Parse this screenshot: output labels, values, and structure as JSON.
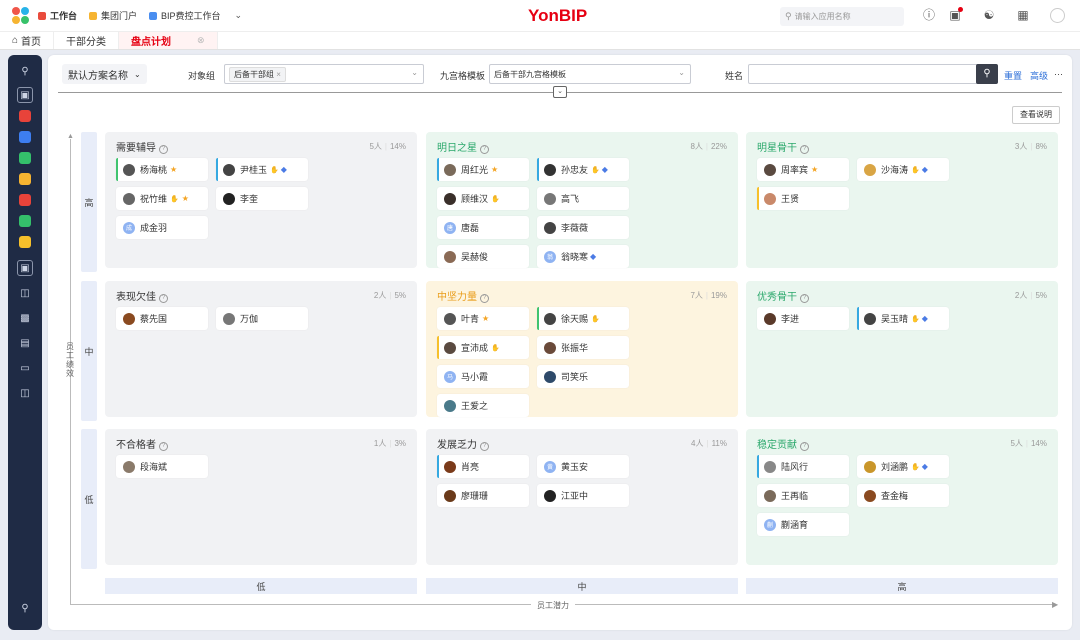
{
  "topbar": {
    "tabs": [
      {
        "label": "工作台",
        "color": "#e94b3c",
        "active": true
      },
      {
        "label": "集团门户",
        "color": "#f6b431",
        "active": false
      },
      {
        "label": "BIP费控工作台",
        "color": "#4a8ef0",
        "active": false
      }
    ],
    "more_icon": "chevron-down-icon",
    "brand": "YonBIP",
    "search_placeholder": "请输入应用名称"
  },
  "page_tabs": [
    {
      "label": "首页",
      "icon": "home-icon"
    },
    {
      "label": "干部分类"
    },
    {
      "label": "盘点计划",
      "active": true
    }
  ],
  "filter": {
    "scheme": "默认方案名称",
    "object_group_label": "对象组",
    "object_group_value": "后备干部组",
    "grid_template_label": "九宫格模板",
    "grid_template_value": "后备干部九宫格模板",
    "name_label": "姓名",
    "name_value": "",
    "reset": "重置",
    "advanced": "高级",
    "more": "···"
  },
  "explain_button": "查看说明",
  "axes": {
    "y_label": "员工绩效",
    "x_label": "员工潜力",
    "rows": [
      "高",
      "中",
      "低"
    ],
    "cols": [
      "低",
      "中",
      "高"
    ]
  },
  "grid": [
    {
      "title": "需要辅导",
      "count": "5人",
      "pct": "14%",
      "tone": "gray",
      "people": [
        {
          "name": "杨海桃",
          "mark": "green",
          "avatar": "#555",
          "badges": [
            "star"
          ]
        },
        {
          "name": "尹桂玉",
          "mark": "blue",
          "avatar": "#444",
          "badges": [
            "thumb",
            "shield"
          ]
        },
        {
          "name": "祝竹维",
          "mark": "",
          "avatar": "#666",
          "badges": [
            "thumb",
            "star"
          ]
        },
        {
          "name": "李奎",
          "mark": "",
          "avatar": "#222",
          "badges": []
        },
        {
          "name": "成金羽",
          "mark": "",
          "avatar": "#8fb3f2",
          "initial": "成",
          "badges": []
        }
      ]
    },
    {
      "title": "明日之星",
      "count": "8人",
      "pct": "22%",
      "tone": "green",
      "people": [
        {
          "name": "周红光",
          "mark": "blue",
          "avatar": "#7a6a5a",
          "badges": [
            "star"
          ]
        },
        {
          "name": "孙忠友",
          "mark": "blue",
          "avatar": "#333",
          "badges": [
            "thumb",
            "shield"
          ]
        },
        {
          "name": "顾维汉",
          "mark": "",
          "avatar": "#3a2f2a",
          "badges": [
            "thumb"
          ]
        },
        {
          "name": "高飞",
          "mark": "",
          "avatar": "#777",
          "badges": []
        },
        {
          "name": "唐磊",
          "mark": "",
          "avatar": "#8fb3f2",
          "initial": "唐",
          "badges": []
        },
        {
          "name": "李薇薇",
          "mark": "",
          "avatar": "#444",
          "badges": []
        },
        {
          "name": "吴赫俊",
          "mark": "",
          "avatar": "#8a6a55",
          "badges": []
        },
        {
          "name": "翁晓寒",
          "mark": "",
          "avatar": "#8fb3f2",
          "initial": "翁",
          "badges": [
            "shield"
          ]
        }
      ]
    },
    {
      "title": "明星骨干",
      "count": "3人",
      "pct": "8%",
      "tone": "green",
      "people": [
        {
          "name": "周率宾",
          "mark": "",
          "avatar": "#5a4a40",
          "badges": [
            "star"
          ]
        },
        {
          "name": "沙海涛",
          "mark": "",
          "avatar": "#d9a545",
          "badges": [
            "thumb",
            "shield"
          ]
        },
        {
          "name": "王贤",
          "mark": "yellow",
          "avatar": "#c9896a",
          "badges": []
        }
      ]
    },
    {
      "title": "表现欠佳",
      "count": "2人",
      "pct": "5%",
      "tone": "gray",
      "people": [
        {
          "name": "蔡先国",
          "mark": "",
          "avatar": "#8a4a20",
          "badges": []
        },
        {
          "name": "万伽",
          "mark": "",
          "avatar": "#777",
          "badges": []
        }
      ]
    },
    {
      "title": "中坚力量",
      "count": "7人",
      "pct": "19%",
      "tone": "yellow",
      "people": [
        {
          "name": "叶青",
          "mark": "",
          "avatar": "#555",
          "badges": [
            "star"
          ]
        },
        {
          "name": "徐天赐",
          "mark": "green",
          "avatar": "#444",
          "badges": [
            "thumb"
          ]
        },
        {
          "name": "宣沛成",
          "mark": "yellow",
          "avatar": "#5a4a40",
          "badges": [
            "thumb"
          ]
        },
        {
          "name": "张振华",
          "mark": "",
          "avatar": "#6a4a3a",
          "badges": []
        },
        {
          "name": "马小霞",
          "mark": "",
          "avatar": "#8fb3f2",
          "initial": "马",
          "badges": []
        },
        {
          "name": "司笑乐",
          "mark": "",
          "avatar": "#2e4a6a",
          "badges": []
        },
        {
          "name": "王爱之",
          "mark": "",
          "avatar": "#4a7a8a",
          "badges": []
        }
      ]
    },
    {
      "title": "优秀骨干",
      "count": "2人",
      "pct": "5%",
      "tone": "green",
      "people": [
        {
          "name": "李进",
          "mark": "",
          "avatar": "#5a3a2a",
          "badges": []
        },
        {
          "name": "吴玉晴",
          "mark": "blue",
          "avatar": "#444",
          "badges": [
            "thumb",
            "shield"
          ]
        }
      ]
    },
    {
      "title": "不合格者",
      "count": "1人",
      "pct": "3%",
      "tone": "gray",
      "people": [
        {
          "name": "段海斌",
          "mark": "",
          "avatar": "#8a7a6a",
          "badges": []
        }
      ]
    },
    {
      "title": "发展乏力",
      "count": "4人",
      "pct": "11%",
      "tone": "gray",
      "people": [
        {
          "name": "肖亮",
          "mark": "blue",
          "avatar": "#7a3a1a",
          "badges": []
        },
        {
          "name": "黄玉安",
          "mark": "",
          "avatar": "#8fb3f2",
          "initial": "黄",
          "badges": []
        },
        {
          "name": "廖珊珊",
          "mark": "",
          "avatar": "#6a3a1a",
          "badges": []
        },
        {
          "name": "江亚中",
          "mark": "",
          "avatar": "#222",
          "badges": []
        }
      ]
    },
    {
      "title": "稳定贡献",
      "count": "5人",
      "pct": "14%",
      "tone": "green",
      "people": [
        {
          "name": "陆风行",
          "mark": "blue",
          "avatar": "#888",
          "badges": []
        },
        {
          "name": "刘涵鹏",
          "mark": "",
          "avatar": "#c9962a",
          "badges": [
            "thumb",
            "shield"
          ]
        },
        {
          "name": "王再临",
          "mark": "",
          "avatar": "#7a6a5a",
          "badges": []
        },
        {
          "name": "查金梅",
          "mark": "",
          "avatar": "#8a4a20",
          "badges": []
        },
        {
          "name": "蒯涵育",
          "mark": "",
          "avatar": "#8fb3f2",
          "initial": "蒯",
          "badges": []
        }
      ]
    }
  ]
}
